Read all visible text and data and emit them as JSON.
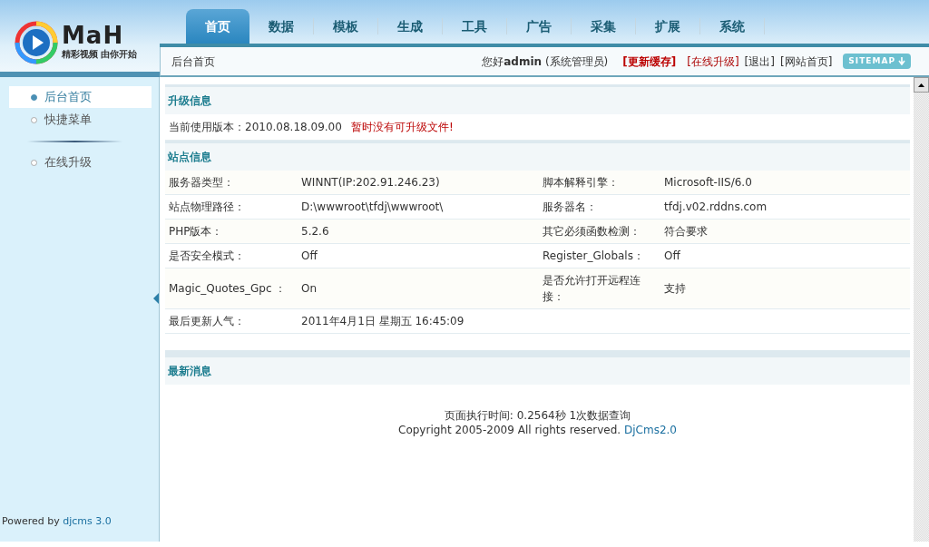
{
  "logo": {
    "name": "MaH",
    "tagline": "精彩视频 由你开始"
  },
  "nav_tabs": [
    {
      "label": "首页",
      "selected": true
    },
    {
      "label": "数据",
      "selected": false
    },
    {
      "label": "模板",
      "selected": false
    },
    {
      "label": "生成",
      "selected": false
    },
    {
      "label": "工具",
      "selected": false
    },
    {
      "label": "广告",
      "selected": false
    },
    {
      "label": "采集",
      "selected": false
    },
    {
      "label": "扩展",
      "selected": false
    },
    {
      "label": "系统",
      "selected": false
    }
  ],
  "breadcrumb": "后台首页",
  "user_bar": {
    "greeting": "您好",
    "user": "admin",
    "role": "(系统管理员)",
    "links": [
      {
        "label": "[更新缓存]",
        "kind": "strong"
      },
      {
        "label": "[在线升级]",
        "kind": "alert"
      },
      {
        "label": "[退出]",
        "kind": "plain"
      },
      {
        "label": "[网站首页]",
        "kind": "plain"
      }
    ],
    "sitemap": "SITEMAP"
  },
  "sidebar": {
    "groups": [
      [
        {
          "label": "后台首页",
          "selected": true
        },
        {
          "label": "快捷菜单",
          "selected": false
        }
      ],
      [
        {
          "label": "在线升级",
          "selected": false
        }
      ]
    ],
    "powered_by": "Powered by",
    "powered_link": "djcms 3.0"
  },
  "upgrade": {
    "title": "升级信息",
    "version": "当前使用版本：2010.08.18.09.00",
    "notice": "暂时没有可升级文件!"
  },
  "site_info": {
    "title": "站点信息",
    "rows": [
      [
        "服务器类型：",
        "WINNT(IP:202.91.246.23)",
        "脚本解释引擎：",
        "Microsoft-IIS/6.0"
      ],
      [
        "站点物理路径：",
        "D:\\wwwroot\\tfdj\\wwwroot\\",
        "服务器名：",
        "tfdj.v02.rddns.com"
      ],
      [
        "PHP版本：",
        "5.2.6",
        "其它必须函数检测：",
        "符合要求"
      ],
      [
        "是否安全模式：",
        "Off",
        "Register_Globals：",
        "Off"
      ],
      [
        "Magic_Quotes_Gpc ：",
        "On",
        "是否允许打开远程连接：",
        "支持"
      ],
      [
        "最后更新人气：",
        "2011年4月1日 星期五 16:45:09"
      ]
    ]
  },
  "news": {
    "title": "最新消息"
  },
  "footer": {
    "timing": "页面执行时间: 0.2564秒 1次数据查询",
    "copyright": "Copyright 2005-2009 All rights reserved.",
    "link": "DjCms2.0"
  }
}
